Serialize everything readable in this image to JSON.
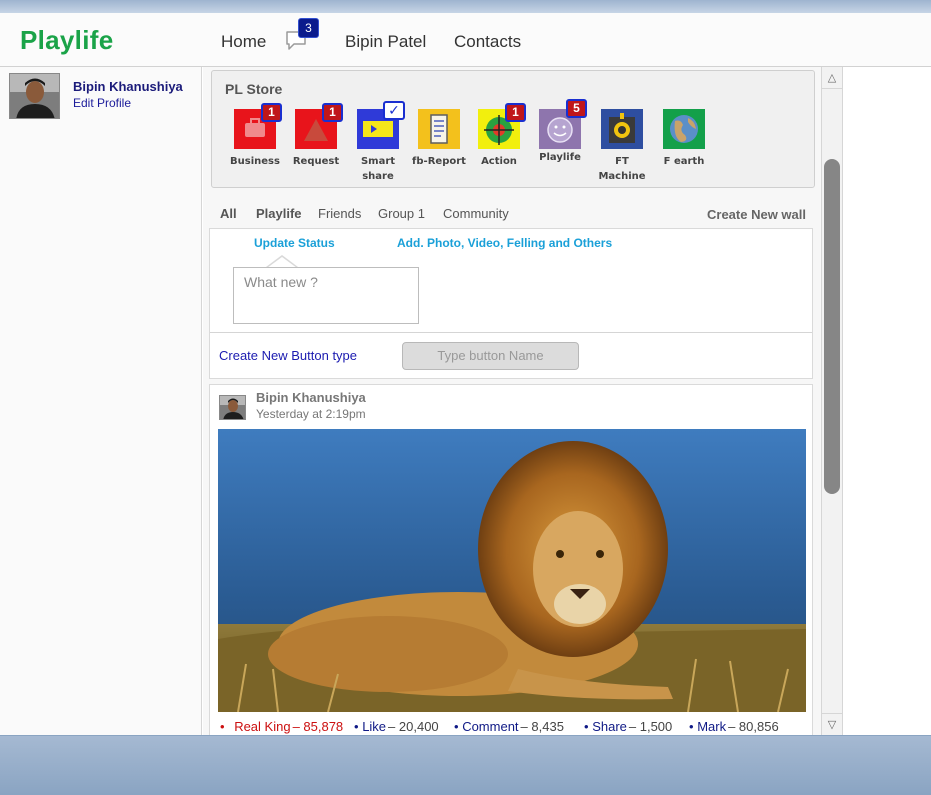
{
  "header": {
    "logo": "Playlife",
    "nav_home": "Home",
    "message_count": "3",
    "nav_user": "Bipin Patel",
    "nav_contacts": "Contacts"
  },
  "profile": {
    "name": "Bipin Khanushiya",
    "edit_link": "Edit Profile"
  },
  "store": {
    "title": "PL Store",
    "apps": [
      {
        "label": "Business",
        "badge": "1",
        "color": "#e8141b",
        "icon": "briefcase-icon"
      },
      {
        "label": "Request",
        "badge": "1",
        "color": "#e8141b",
        "icon": "request-icon"
      },
      {
        "label": "Smart share",
        "badge": "✓",
        "color": "#2f3ad8",
        "icon": "smart-share-icon"
      },
      {
        "label": "fb-Report",
        "badge": "",
        "color": "#f3c11c",
        "icon": "report-icon"
      },
      {
        "label": "Action",
        "badge": "1",
        "color": "#f2ef0d",
        "icon": "action-icon"
      },
      {
        "label": "Playlife",
        "badge": "5",
        "color": "#8e75ad",
        "icon": "smiley-icon"
      },
      {
        "label": "FT Machine",
        "badge": "",
        "color": "#2e4ea0",
        "icon": "machine-icon"
      },
      {
        "label": "F earth",
        "badge": "",
        "color": "#13a04a",
        "icon": "globe-icon"
      }
    ]
  },
  "filters": {
    "items": [
      "All",
      "Playlife",
      "Friends",
      "Group 1",
      "Community"
    ],
    "create_wall": "Create New wall"
  },
  "composer": {
    "tab_update": "Update Status",
    "tab_add": "Add. Photo, Video, Felling and Others",
    "placeholder": "What new ?",
    "create_button_type": "Create New Button type",
    "button_name_placeholder": "Type button Name"
  },
  "post": {
    "author": "Bipin Khanushiya",
    "time": "Yesterday at 2:19pm",
    "reactions": [
      {
        "label": "Real King",
        "count": "– 85,878",
        "highlight": true
      },
      {
        "label": "Like",
        "count": "– 20,400",
        "highlight": false
      },
      {
        "label": "Comment",
        "count": "– 8,435",
        "highlight": false
      },
      {
        "label": "Share",
        "count": "– 1,500",
        "highlight": false
      },
      {
        "label": "Mark",
        "count": "– 80,856",
        "highlight": false
      }
    ]
  },
  "scrollbar": {
    "up_arrow": "△",
    "down_arrow": "▽"
  },
  "colors": {
    "logo_green": "#1aa348",
    "link_blue": "#1b1b9a",
    "tab_cyan": "#1aa0d8",
    "badge_red": "#c0161b",
    "badge_border": "#1a2fd0"
  }
}
